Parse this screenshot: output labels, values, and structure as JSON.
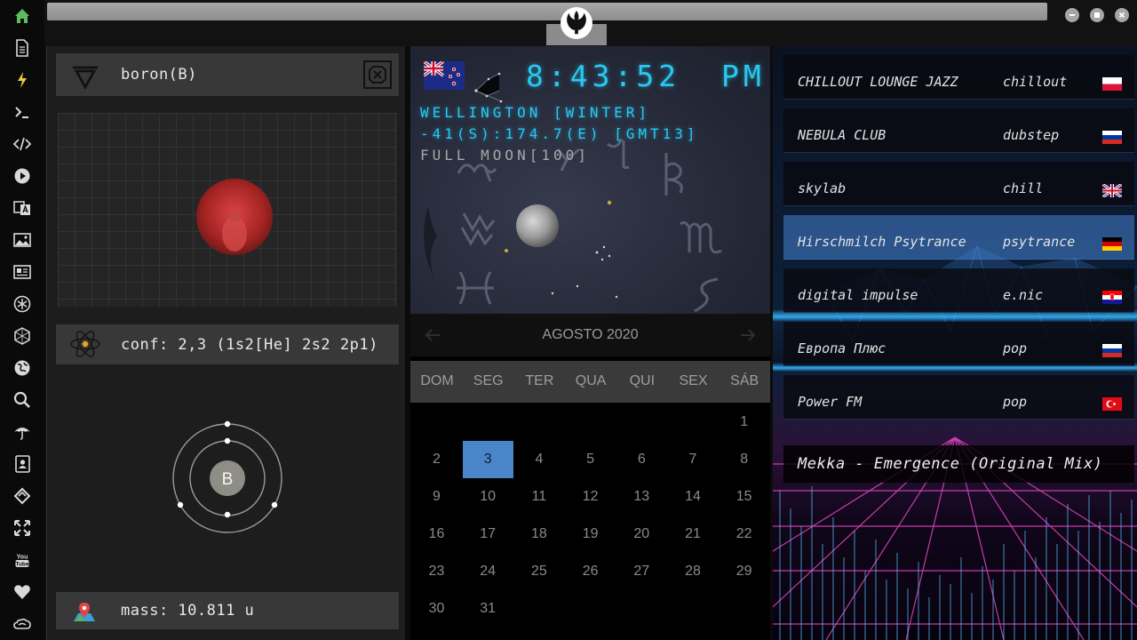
{
  "rail": {
    "items": [
      {
        "name": "home-icon",
        "color": "#5cbd5c"
      },
      {
        "name": "document-icon"
      },
      {
        "name": "lightning-icon",
        "color": "#e6c84a"
      },
      {
        "name": "terminal-icon"
      },
      {
        "name": "code-icon"
      },
      {
        "name": "play-icon"
      },
      {
        "name": "translate-icon"
      },
      {
        "name": "image-icon"
      },
      {
        "name": "news-icon"
      },
      {
        "name": "atom-symbol-icon"
      },
      {
        "name": "hexagon-icon"
      },
      {
        "name": "globe-icon"
      },
      {
        "name": "search-icon"
      },
      {
        "name": "umbrella-icon"
      },
      {
        "name": "contacts-icon"
      },
      {
        "name": "tag-icon"
      },
      {
        "name": "expand-icon"
      },
      {
        "name": "youtube-icon"
      },
      {
        "name": "heart-icon"
      },
      {
        "name": "cloud-icon"
      }
    ]
  },
  "element": {
    "name_label": "boron(B)",
    "config_label": "conf: 2,3 (1s2[He] 2s2 2p1)",
    "mass_label": "mass: 10.811 u",
    "symbol": "B",
    "shells": [
      2,
      3
    ],
    "accent": "#d02a2a"
  },
  "clock": {
    "time": "8:43:52",
    "ampm": "PM",
    "city": "WELLINGTON [WINTER]",
    "coords": "-41(S):174.7(E) [GMT13]",
    "moon": "FULL MOON[100]",
    "lcd_color": "#28c8f0"
  },
  "calendar": {
    "month": "AGOSTO 2020",
    "weekdays": [
      "DOM",
      "SEG",
      "TER",
      "QUA",
      "QUI",
      "SEX",
      "SÁB"
    ],
    "first_weekday": 6,
    "days": 31,
    "selected": 3,
    "selected_color": "#4a85c9"
  },
  "radio": {
    "stations": [
      {
        "name": "CHILLOUT LOUNGE JAZZ",
        "genre": "chillout",
        "flag": "poland",
        "active": false
      },
      {
        "name": "NEBULA CLUB",
        "genre": "dubstep",
        "flag": "russia",
        "active": false
      },
      {
        "name": "skylab",
        "genre": "chill",
        "flag": "uk",
        "active": false
      },
      {
        "name": "Hirschmilch Psytrance",
        "genre": "psytrance",
        "flag": "germany",
        "active": true
      },
      {
        "name": "digital impulse",
        "genre": "e.nic",
        "flag": "croatia",
        "active": false
      },
      {
        "name": "Европа Плюс",
        "genre": "pop",
        "flag": "russia",
        "active": false
      },
      {
        "name": "Power FM",
        "genre": "pop",
        "flag": "turkey",
        "active": false
      }
    ],
    "now_playing": "Mekka - Emergence (Original Mix)"
  }
}
